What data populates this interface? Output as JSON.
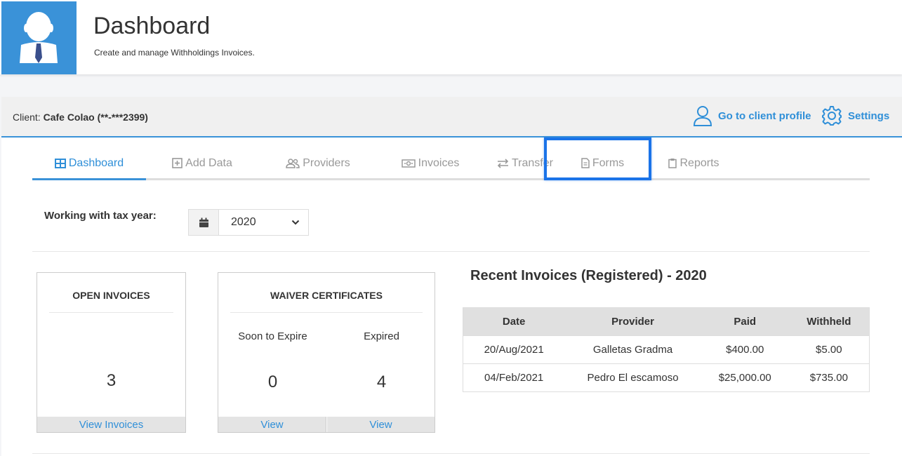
{
  "header": {
    "title": "Dashboard",
    "subtitle": "Create and manage Withholdings Invoices.",
    "avatar_icon": "user-tie-icon",
    "accent": "#3a92d8"
  },
  "client_bar": {
    "label": "Client:",
    "client_name": "Cafe Colao (**-***2399)",
    "profile_link": "Go to client profile",
    "settings_link": "Settings"
  },
  "tabs": [
    {
      "label": "Dashboard",
      "icon": "table-icon",
      "active": true
    },
    {
      "label": "Add Data",
      "icon": "plus-square-icon"
    },
    {
      "label": "Providers",
      "icon": "users-icon"
    },
    {
      "label": "Invoices",
      "icon": "money-bill-icon"
    },
    {
      "label": "Transfer",
      "icon": "exchange-icon"
    },
    {
      "label": "Forms",
      "icon": "file-icon",
      "highlighted": true
    },
    {
      "label": "Reports",
      "icon": "clipboard-icon"
    }
  ],
  "tax_year": {
    "label": "Working with tax year:",
    "value": "2020"
  },
  "cards": {
    "open_invoices": {
      "title": "OPEN INVOICES",
      "count": "3",
      "link": "View Invoices"
    },
    "waiver_certificates": {
      "title": "WAIVER CERTIFICATES",
      "soon_label": "Soon to Expire",
      "soon_count": "0",
      "expired_label": "Expired",
      "expired_count": "4",
      "soon_link": "View",
      "expired_link": "View"
    }
  },
  "recent": {
    "title": "Recent Invoices (Registered) - 2020",
    "columns": [
      "Date",
      "Provider",
      "Paid",
      "Withheld"
    ],
    "rows": [
      [
        "20/Aug/2021",
        "Galletas Gradma",
        "$400.00",
        "$5.00"
      ],
      [
        "04/Feb/2021",
        "Pedro El escamoso",
        "$25,000.00",
        "$735.00"
      ]
    ]
  }
}
